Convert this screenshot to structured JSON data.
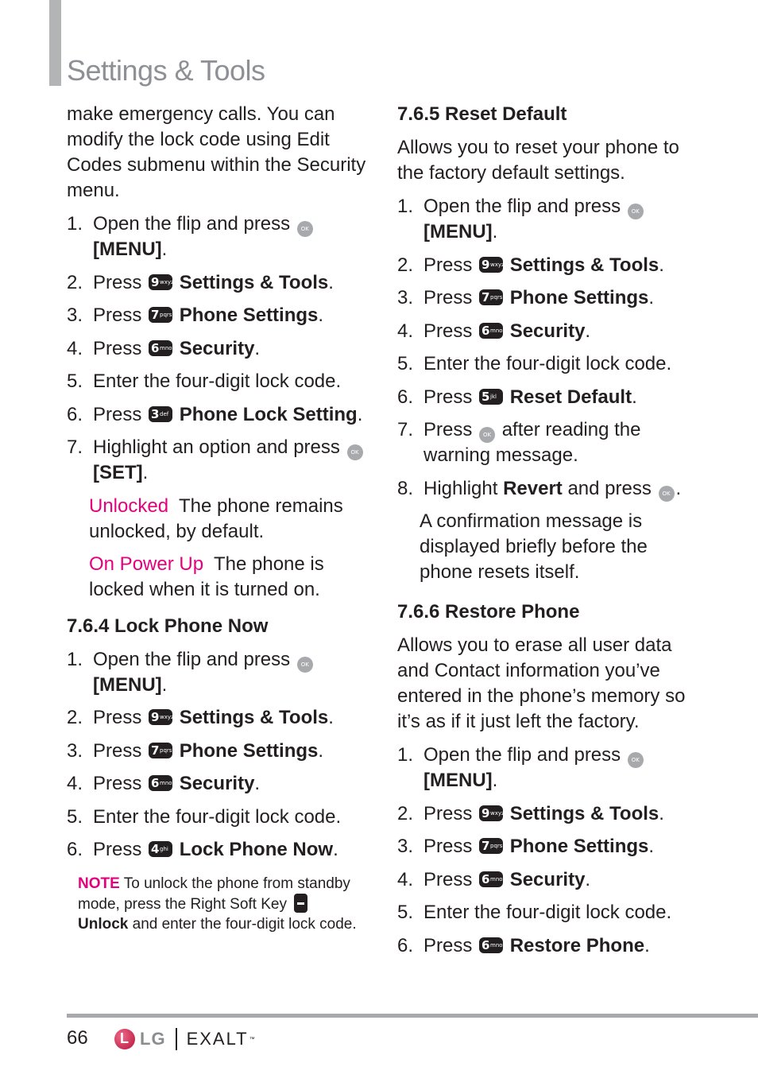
{
  "header": {
    "title": "Settings & Tools"
  },
  "left": {
    "intro": "make emergency calls. You can modify the lock code using Edit Codes submenu within the Security menu.",
    "steps": [
      {
        "num": "1.",
        "pre": "Open the flip and press",
        "key": "ok",
        "bold": "[MENU]",
        "post": "."
      },
      {
        "num": "2.",
        "pre": "Press",
        "key": "9",
        "bold": "Settings & Tools",
        "post": "."
      },
      {
        "num": "3.",
        "pre": "Press",
        "key": "7",
        "bold": "Phone Settings",
        "post": "."
      },
      {
        "num": "4.",
        "pre": "Press",
        "key": "6",
        "bold": "Security",
        "post": "."
      },
      {
        "num": "5.",
        "pre": "Enter the four-digit lock code.",
        "key": "",
        "bold": "",
        "post": ""
      },
      {
        "num": "6.",
        "pre": "Press",
        "key": "3",
        "bold": "Phone Lock Setting",
        "post": "."
      },
      {
        "num": "7.",
        "pre": "Highlight an option and press",
        "key": "ok",
        "bold": "[SET]",
        "post": "."
      }
    ],
    "options": [
      {
        "label": "Unlocked",
        "text": "The phone remains unlocked, by default."
      },
      {
        "label": "On Power Up",
        "text": "The phone is locked when it is turned on."
      }
    ],
    "section_764": {
      "heading": "7.6.4 Lock Phone Now",
      "steps": [
        {
          "num": "1.",
          "pre": "Open the flip and press",
          "key": "ok",
          "bold": "[MENU]",
          "post": "."
        },
        {
          "num": "2.",
          "pre": "Press",
          "key": "9",
          "bold": "Settings & Tools",
          "post": "."
        },
        {
          "num": "3.",
          "pre": "Press",
          "key": "7",
          "bold": "Phone Settings",
          "post": "."
        },
        {
          "num": "4.",
          "pre": "Press",
          "key": "6",
          "bold": "Security",
          "post": "."
        },
        {
          "num": "5.",
          "pre": "Enter the four-digit lock code.",
          "key": "",
          "bold": "",
          "post": ""
        },
        {
          "num": "6.",
          "pre": "Press",
          "key": "4",
          "bold": "Lock Phone Now",
          "post": "."
        }
      ],
      "note": {
        "label": "NOTE",
        "text1": "To unlock the phone from standby mode, press the Right Soft Key",
        "bold": "Unlock",
        "text2": "and enter the four-digit lock code."
      }
    }
  },
  "right": {
    "section_765": {
      "heading": "7.6.5 Reset Default",
      "intro": "Allows you to reset your phone to the factory default settings.",
      "steps": [
        {
          "num": "1.",
          "pre": "Open the flip and press",
          "key": "ok",
          "bold": "[MENU]",
          "post": "."
        },
        {
          "num": "2.",
          "pre": "Press",
          "key": "9",
          "bold": "Settings & Tools",
          "post": "."
        },
        {
          "num": "3.",
          "pre": "Press",
          "key": "7",
          "bold": "Phone Settings",
          "post": "."
        },
        {
          "num": "4.",
          "pre": "Press",
          "key": "6",
          "bold": "Security",
          "post": "."
        },
        {
          "num": "5.",
          "pre": "Enter the four-digit lock code.",
          "key": "",
          "bold": "",
          "post": ""
        },
        {
          "num": "6.",
          "pre": "Press",
          "key": "5",
          "bold": "Reset Default",
          "post": "."
        },
        {
          "num": "7.",
          "pre": "Press",
          "key": "ok",
          "bold": "",
          "post": "after reading the warning message."
        },
        {
          "num": "8.",
          "pre": "Highlight",
          "key": "",
          "bold": "Revert",
          "post": "and press",
          "key2": "ok",
          "end": "."
        }
      ],
      "confirmation": "A confirmation message is displayed briefly before the phone resets itself."
    },
    "section_766": {
      "heading": "7.6.6 Restore Phone",
      "intro": "Allows you to erase all user data and Contact information you’ve entered in the phone’s memory so it’s as if it just left the factory.",
      "steps": [
        {
          "num": "1.",
          "pre": "Open the flip and press",
          "key": "ok",
          "bold": "[MENU]",
          "post": "."
        },
        {
          "num": "2.",
          "pre": "Press",
          "key": "9",
          "bold": "Settings & Tools",
          "post": "."
        },
        {
          "num": "3.",
          "pre": "Press",
          "key": "7",
          "bold": "Phone Settings",
          "post": "."
        },
        {
          "num": "4.",
          "pre": "Press",
          "key": "6",
          "bold": "Security",
          "post": "."
        },
        {
          "num": "5.",
          "pre": "Enter the four-digit lock code.",
          "key": "",
          "bold": "",
          "post": ""
        },
        {
          "num": "6.",
          "pre": "Press",
          "key": "6",
          "bold": "Restore Phone",
          "post": "."
        }
      ]
    }
  },
  "keys": {
    "ok": "OK",
    "3": {
      "digit": "3",
      "letters": "def"
    },
    "4": {
      "digit": "4",
      "letters": "ghi"
    },
    "5": {
      "digit": "5",
      "letters": "jkl"
    },
    "6": {
      "digit": "6",
      "letters": "mno"
    },
    "7": {
      "digit": "7",
      "letters": "pqrs"
    },
    "9": {
      "digit": "9",
      "letters": "wxyz"
    }
  },
  "footer": {
    "page_number": "66",
    "brand": "LG",
    "product": "EXALT",
    "trademark": "™"
  },
  "colors": {
    "accent_pink": "#e5007e",
    "title_gray": "#8e9095",
    "rule_gray": "#a7a9ac"
  }
}
